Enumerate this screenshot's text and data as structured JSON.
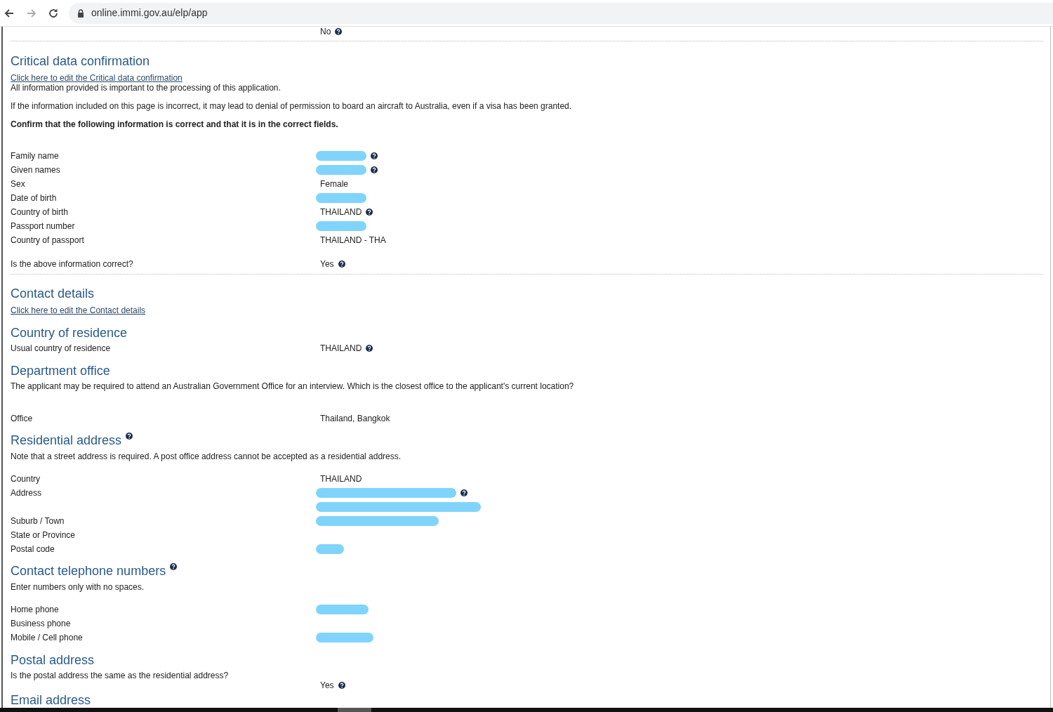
{
  "browser": {
    "url": "online.immi.gov.au/elp/app"
  },
  "items": [
    {
      "kind": "field",
      "value": "No",
      "help": true,
      "divider": true
    },
    {
      "kind": "heading",
      "text": "Critical data confirmation"
    },
    {
      "kind": "link",
      "text": "Click here to edit the Critical data confirmation"
    },
    {
      "kind": "text",
      "text": "All information provided is important to the processing of this application."
    },
    {
      "kind": "text",
      "text": "If the information included on this page is incorrect, it may lead to denial of permission to board an aircraft to Australia, even if a visa has been granted."
    },
    {
      "kind": "text",
      "text": "Confirm that the following information is correct and that it is in the correct fields.",
      "bold": true
    },
    {
      "kind": "field",
      "label": "Family name",
      "redacted": true,
      "help": true
    },
    {
      "kind": "field",
      "label": "Given names",
      "redacted": true,
      "help": true
    },
    {
      "kind": "field",
      "label": "Sex",
      "value": "Female"
    },
    {
      "kind": "field",
      "label": "Date of birth",
      "redacted": true
    },
    {
      "kind": "field",
      "label": "Country of birth",
      "value": "THAILAND",
      "help": true
    },
    {
      "kind": "field",
      "label": "Passport number",
      "redacted": true
    },
    {
      "kind": "field",
      "label": "Country of passport",
      "value": "THAILAND - THA"
    },
    {
      "kind": "field",
      "label": "Is the above information correct?",
      "value": "Yes",
      "help": true,
      "divider": true
    },
    {
      "kind": "heading",
      "text": "Contact details"
    },
    {
      "kind": "link",
      "text": "Click here to edit the Contact details"
    },
    {
      "kind": "heading",
      "text": "Country of residence"
    },
    {
      "kind": "field",
      "label": "Usual country of residence",
      "value": "THAILAND",
      "help": true
    },
    {
      "kind": "heading",
      "text": "Department office"
    },
    {
      "kind": "text",
      "text": "The applicant may be required to attend an Australian Government Office for an interview. Which is the closest office to the applicant's current location?"
    },
    {
      "kind": "field",
      "label": "Office",
      "value": "Thailand, Bangkok"
    },
    {
      "kind": "heading",
      "text": "Residential address",
      "help": true
    },
    {
      "kind": "text",
      "text": "Note that a street address is required. A post office address cannot be accepted as a residential address."
    },
    {
      "kind": "field",
      "label": "Country",
      "value": "THAILAND"
    },
    {
      "kind": "field",
      "label": "Address",
      "redacted": true,
      "help": true
    },
    {
      "kind": "field",
      "redacted": true
    },
    {
      "kind": "field",
      "label": "Suburb / Town",
      "redacted": true
    },
    {
      "kind": "field",
      "label": "State or Province"
    },
    {
      "kind": "field",
      "label": "Postal code",
      "redacted": true
    },
    {
      "kind": "heading",
      "text": "Contact telephone numbers",
      "help": true
    },
    {
      "kind": "text",
      "text": "Enter numbers only with no spaces."
    },
    {
      "kind": "field",
      "label": "Home phone",
      "redacted": true
    },
    {
      "kind": "field",
      "label": "Business phone"
    },
    {
      "kind": "field",
      "label": "Mobile / Cell phone",
      "redacted": true
    },
    {
      "kind": "heading",
      "text": "Postal address"
    },
    {
      "kind": "field",
      "label": "Is the postal address the same as the residential address?"
    },
    {
      "kind": "field",
      "value": "Yes",
      "help": true
    },
    {
      "kind": "heading",
      "text": "Email address"
    }
  ]
}
